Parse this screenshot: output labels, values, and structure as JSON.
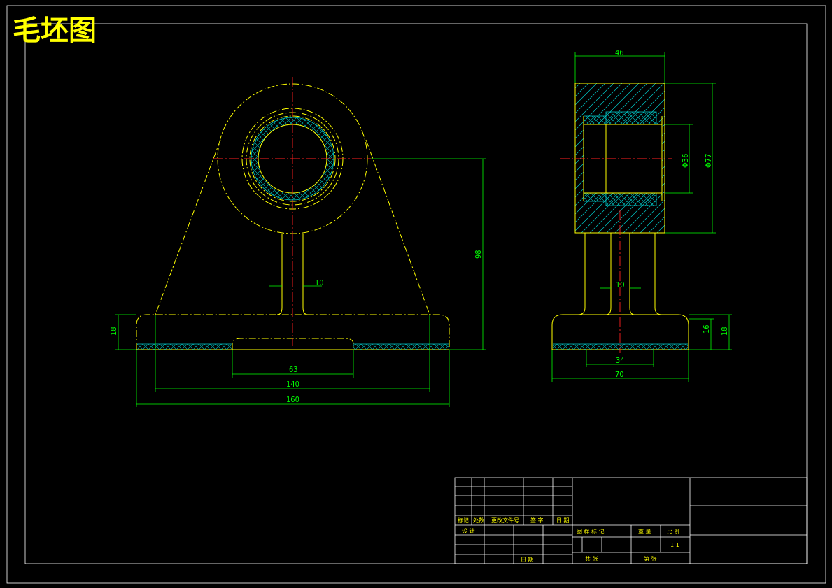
{
  "drawing": {
    "title": "毛坯图",
    "front_dims": {
      "d10": "10",
      "d63": "63",
      "d140": "140",
      "d160": "160",
      "d18": "18",
      "d98": "98"
    },
    "side_dims": {
      "d46": "46",
      "d10": "10",
      "d34": "34",
      "d70": "70",
      "d16": "16",
      "d18": "18",
      "phi36": "Φ36",
      "phi77": "Φ77"
    }
  },
  "title_block": {
    "row_labels": [
      "标记",
      "处数",
      "更改文件号",
      "签  字",
      "日 期"
    ],
    "design": "设 计",
    "date": "日 期",
    "stage": "图 样 标 记",
    "weight": "重 量",
    "scale": "比 例",
    "scale_value": "1:1",
    "total": "共     张",
    "sheet": "第     张"
  },
  "colors": {
    "outline": "#ffff00",
    "dimension": "#00ff00",
    "centerline": "#ff2020",
    "hatch": "#00cccc",
    "frame": "#ffffff"
  }
}
